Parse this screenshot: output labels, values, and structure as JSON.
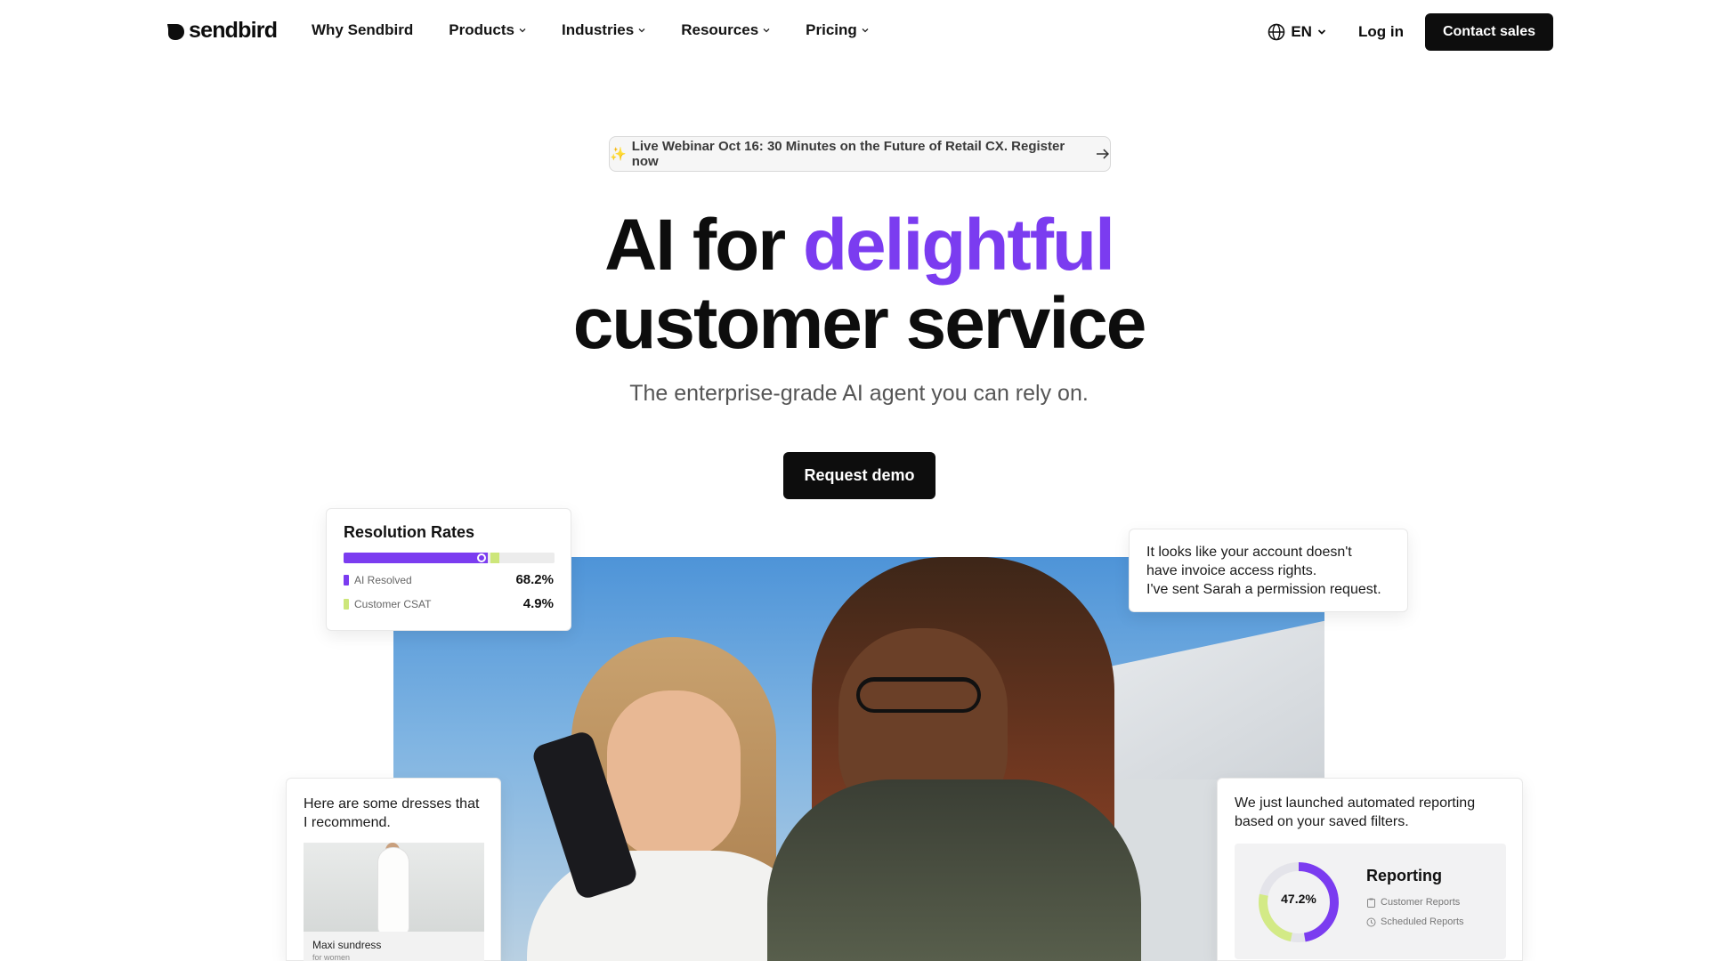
{
  "brand": {
    "name": "sendbird"
  },
  "nav": {
    "items": [
      {
        "label": "Why Sendbird",
        "has_dropdown": false
      },
      {
        "label": "Products",
        "has_dropdown": true
      },
      {
        "label": "Industries",
        "has_dropdown": true
      },
      {
        "label": "Resources",
        "has_dropdown": true
      },
      {
        "label": "Pricing",
        "has_dropdown": true
      }
    ],
    "language": "EN",
    "login": "Log in",
    "contact": "Contact sales"
  },
  "hero": {
    "banner": "Live Webinar Oct 16: 30 Minutes on the Future of Retail CX. Register now",
    "banner_icon": "sparkles-icon",
    "title_part1": "AI for ",
    "title_accent": "delightful",
    "title_part2": "customer service",
    "subtitle": "The enterprise-grade AI agent you can rely on.",
    "cta": "Request demo"
  },
  "cards": {
    "resolution": {
      "title": "Resolution Rates",
      "rows": [
        {
          "label": "AI Resolved",
          "value": "68.2%",
          "color": "#7b3cf0"
        },
        {
          "label": "Customer CSAT",
          "value": "4.9%",
          "color": "#cde67a"
        }
      ],
      "fill_fraction": 0.682,
      "csat_fraction": 0.049
    },
    "account_msg": {
      "lines": [
        "It looks like your account doesn't",
        "have invoice access rights.",
        "I've sent Sarah a permission request."
      ]
    },
    "dresses": {
      "lines": [
        "Here are some dresses that",
        "I recommend."
      ],
      "product_name": "Maxi sundress",
      "product_sub": "for women"
    },
    "reporting": {
      "lines": [
        "We just launched automated reporting",
        "based on your saved filters."
      ],
      "title": "Reporting",
      "value": "47.2%",
      "value_fraction": 0.472,
      "items": [
        {
          "label": "Customer Reports",
          "icon": "clipboard-icon"
        },
        {
          "label": "Scheduled Reports",
          "icon": "clock-icon"
        }
      ]
    }
  },
  "colors": {
    "accent": "#7b3cf0",
    "lime": "#cde67a",
    "dark": "#0d0d0d"
  }
}
